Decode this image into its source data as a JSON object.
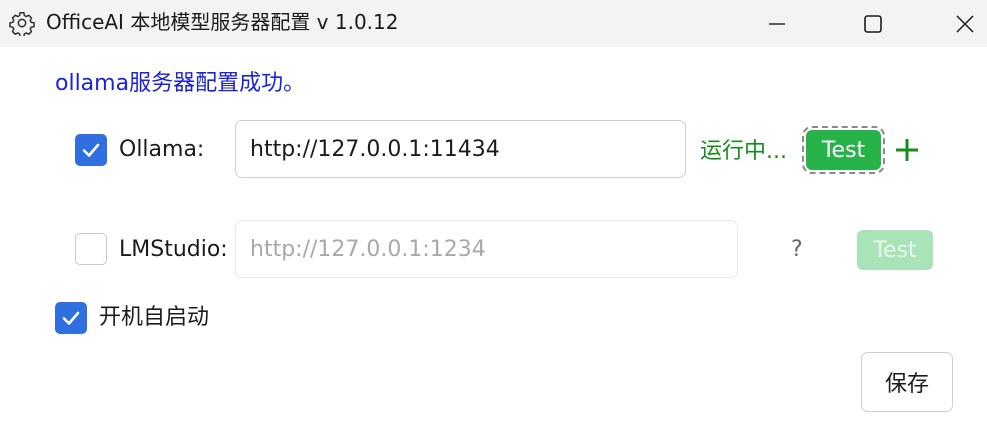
{
  "window": {
    "title": "OfficeAI 本地模型服务器配置 v 1.0.12",
    "icon": "gear-icon"
  },
  "status_message": "ollama服务器配置成功。",
  "servers": [
    {
      "name": "Ollama:",
      "checked": true,
      "url_value": "http://127.0.0.1:11434",
      "status": "运行中...",
      "test_label": "Test",
      "test_enabled": true,
      "add_icon": "plus-icon"
    },
    {
      "name": "LMStudio:",
      "checked": false,
      "url_placeholder": "http://127.0.0.1:1234",
      "status": "?",
      "test_label": "Test",
      "test_enabled": false
    }
  ],
  "autostart": {
    "label": "开机自启动",
    "checked": true
  },
  "save_label": "保存",
  "colors": {
    "status_blue": "#1a23d6",
    "running_green": "#188a1e",
    "test_green": "#27b24a",
    "checkbox_blue": "#2f6fe0"
  }
}
